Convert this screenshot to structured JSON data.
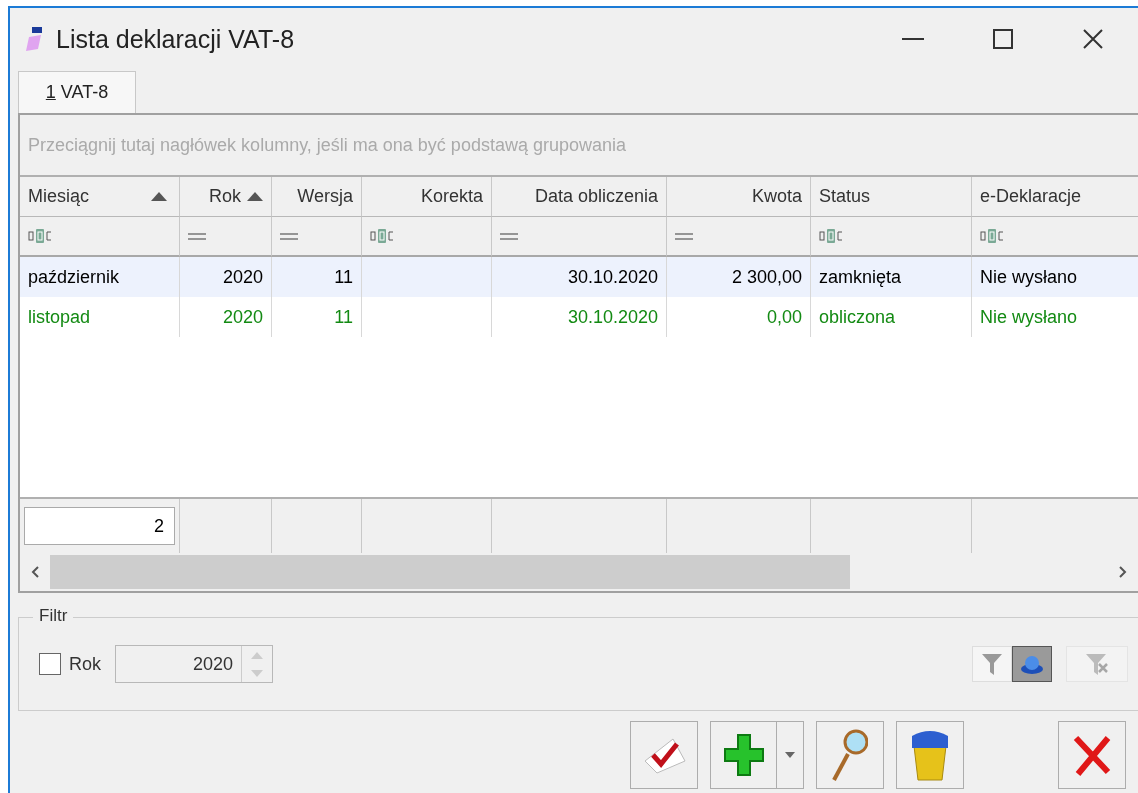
{
  "window": {
    "title": "Lista deklaracji VAT-8"
  },
  "tabs": [
    {
      "label": "VAT-8",
      "hotkey": "1",
      "selected": true
    }
  ],
  "group_by_hint": "Przeciągnij tutaj nagłówek kolumny, jeśli ma ona być podstawą grupowania",
  "table": {
    "columns": [
      {
        "label": "Miesiąc",
        "right_aligned": false,
        "sorted": true,
        "text_filter": true
      },
      {
        "label": "Rok",
        "right_aligned": true,
        "sorted": true,
        "text_filter": false
      },
      {
        "label": "Wersja",
        "right_aligned": true,
        "sorted": false,
        "text_filter": false
      },
      {
        "label": "Korekta",
        "right_aligned": true,
        "sorted": false,
        "text_filter": true
      },
      {
        "label": "Data obliczenia",
        "right_aligned": true,
        "sorted": false,
        "text_filter": false
      },
      {
        "label": "Kwota",
        "right_aligned": true,
        "sorted": false,
        "text_filter": false
      },
      {
        "label": "Status",
        "right_aligned": false,
        "sorted": false,
        "text_filter": true
      },
      {
        "label": "e-Deklaracje",
        "right_aligned": false,
        "sorted": false,
        "text_filter": true
      }
    ],
    "rows": [
      {
        "selected": true,
        "color": "#000000",
        "cells": [
          "październik",
          "2020",
          "11",
          "",
          "30.10.2020",
          "2 300,00",
          "zamknięta",
          "Nie wysłano"
        ]
      },
      {
        "selected": false,
        "color": "#138a13",
        "cells": [
          "listopad",
          "2020",
          "11",
          "",
          "30.10.2020",
          "0,00",
          "obliczona",
          "Nie wysłano"
        ]
      }
    ],
    "footer_count": "2"
  },
  "filter": {
    "title": "Filtr",
    "year_checkbox": {
      "label": "Rok",
      "checked": false
    },
    "year_value": "2020",
    "tools": [
      {
        "kind": "funnel",
        "selected": false,
        "disabled": false
      },
      {
        "kind": "hat",
        "selected": true,
        "disabled": false
      },
      {
        "kind": "funnel-clear",
        "selected": false,
        "disabled": true
      }
    ]
  },
  "actions": [
    {
      "kind": "approve"
    },
    {
      "kind": "add"
    },
    {
      "kind": "preview"
    },
    {
      "kind": "delete"
    },
    {
      "kind": "close"
    }
  ]
}
